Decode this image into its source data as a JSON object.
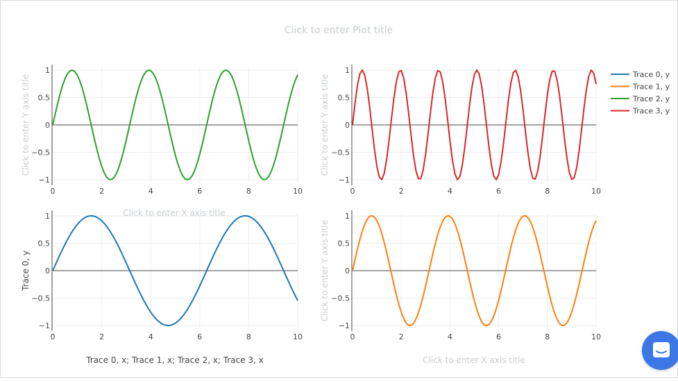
{
  "plot_title": "Click to enter Plot title",
  "placeholders": {
    "y_axis_title": "Click to enter Y axis title",
    "x_axis_title": "Click to enter X axis title"
  },
  "chat_button": {
    "icon": "chat-bubble-icon",
    "color": "#3d77e6"
  },
  "chart_data": [
    {
      "type": "line",
      "panel": "top-left",
      "series": [
        {
          "name": "Trace 2, y",
          "function": "sin(2x)",
          "x_range": [
            0,
            10
          ],
          "sample_step": 0.1,
          "color": "#2ca02c"
        }
      ],
      "xlabel": "Click to enter X axis title",
      "ylabel": "Click to enter Y axis title",
      "xlim": [
        0,
        10
      ],
      "ylim": [
        -1.05,
        1.05
      ],
      "xticks": [
        0,
        2,
        4,
        6,
        8,
        10
      ],
      "yticks": [
        -1,
        -0.5,
        0,
        0.5,
        1
      ],
      "ytick_labels": [
        "−1",
        "−0.5",
        "0",
        "0.5",
        "1"
      ],
      "grid": true
    },
    {
      "type": "line",
      "panel": "top-right",
      "series": [
        {
          "name": "Trace 3, y",
          "function": "sin(4x)",
          "x_range": [
            0,
            10
          ],
          "sample_step": 0.1,
          "color": "#d62728"
        }
      ],
      "xlabel": "",
      "ylabel": "Click to enter Y axis title",
      "xlim": [
        0,
        10
      ],
      "ylim": [
        -1.05,
        1.05
      ],
      "xticks": [
        0,
        2,
        4,
        6,
        8,
        10
      ],
      "yticks": [
        -1,
        -0.5,
        0,
        0.5,
        1
      ],
      "ytick_labels": [
        "−1",
        "−0.5",
        "0",
        "0.5",
        "1"
      ],
      "grid": true
    },
    {
      "type": "line",
      "panel": "bottom-left",
      "series": [
        {
          "name": "Trace 0, y",
          "function": "sin(x)",
          "x_range": [
            0,
            10
          ],
          "sample_step": 0.1,
          "color": "#1f77b4"
        }
      ],
      "xlabel": "Trace 0, x; Trace 1, x; Trace 2, x; Trace 3, x",
      "ylabel": "Trace 0, y",
      "xlim": [
        0,
        10
      ],
      "ylim": [
        -1.05,
        1.05
      ],
      "xticks": [
        0,
        2,
        4,
        6,
        8,
        10
      ],
      "yticks": [
        -1,
        -0.5,
        0,
        0.5,
        1
      ],
      "ytick_labels": [
        "−1",
        "−0.5",
        "0",
        "0.5",
        "1"
      ],
      "grid": true
    },
    {
      "type": "line",
      "panel": "bottom-right",
      "series": [
        {
          "name": "Trace 1, y",
          "function": "sin(2x)",
          "x_range": [
            0,
            10
          ],
          "sample_step": 0.01,
          "color": "#ff7f0e"
        }
      ],
      "xlabel": "Click to enter X axis title",
      "ylabel": "Click to enter Y axis title",
      "xlim": [
        0,
        10
      ],
      "ylim": [
        -1.05,
        1.05
      ],
      "xticks": [
        0,
        2,
        4,
        6,
        8,
        10
      ],
      "yticks": [
        -1,
        -0.5,
        0,
        0.5,
        1
      ],
      "ytick_labels": [
        "−1",
        "−0.5",
        "0",
        "0.5",
        "1"
      ],
      "grid": true
    }
  ],
  "legend": {
    "placement": "top-right",
    "entries": [
      {
        "label": "Trace 0, y",
        "color": "#1f77b4"
      },
      {
        "label": "Trace 1, y",
        "color": "#ff7f0e"
      },
      {
        "label": "Trace 2, y",
        "color": "#2ca02c"
      },
      {
        "label": "Trace 3, y",
        "color": "#d62728"
      }
    ]
  }
}
